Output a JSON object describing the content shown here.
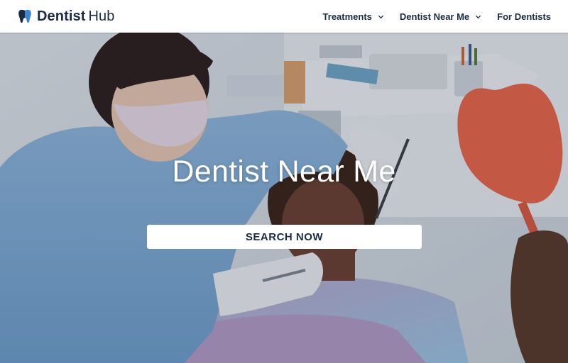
{
  "header": {
    "brand_bold": "Dentist",
    "brand_light": "Hub",
    "logo_icon": "tooth-icon",
    "nav": [
      {
        "label": "Treatments",
        "has_dropdown": true
      },
      {
        "label": "Dentist Near Me",
        "has_dropdown": true
      },
      {
        "label": "For Dentists",
        "has_dropdown": false
      }
    ]
  },
  "hero": {
    "title": "Dentist Near Me",
    "button_label": "SEARCH NOW",
    "image_description_icon": "dentist-patient-photo"
  },
  "colors": {
    "brand_navy": "#1b2a45",
    "logo_blue": "#2f6fb5",
    "header_bg": "#ffffff",
    "button_bg": "#ffffff"
  }
}
